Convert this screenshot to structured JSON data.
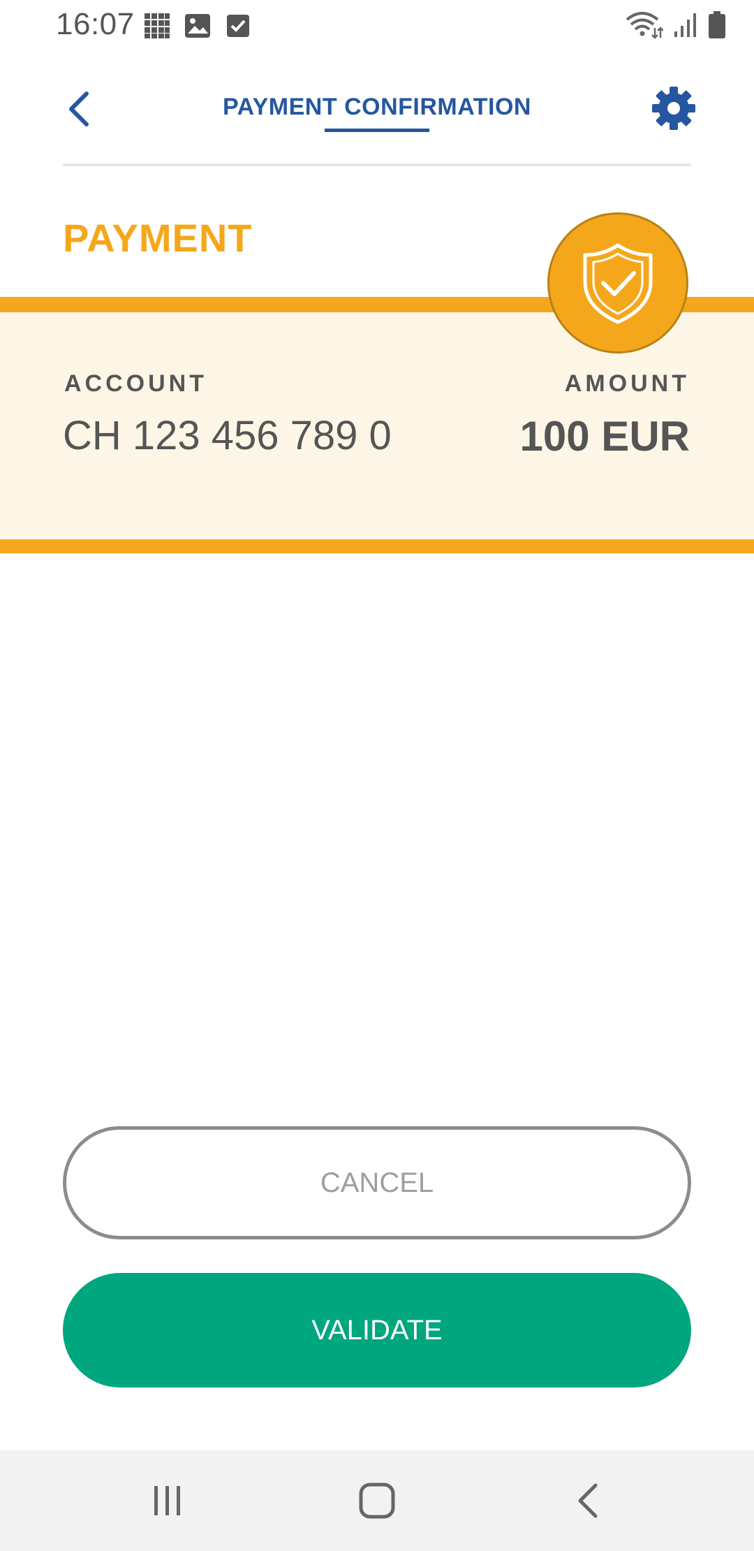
{
  "status_bar": {
    "time": "16:07"
  },
  "header": {
    "title": "PAYMENT CONFIRMATION"
  },
  "section": {
    "title": "PAYMENT"
  },
  "payment": {
    "account_label": "ACCOUNT",
    "account_value": "CH 123 456 789 0",
    "amount_label": "AMOUNT",
    "amount_value": "100 EUR"
  },
  "buttons": {
    "cancel": "CANCEL",
    "validate": "VALIDATE"
  },
  "colors": {
    "primary_blue": "#2557a0",
    "accent_orange": "#f5a71c",
    "band_background": "#fdf6e7",
    "validate_green": "#00a67e",
    "text_gray": "#555555"
  },
  "icons": {
    "back": "back-arrow-icon",
    "settings": "gear-icon",
    "badge": "shield-check-icon",
    "nav_recents": "recents-icon",
    "nav_home": "home-icon",
    "nav_back": "nav-back-icon"
  }
}
